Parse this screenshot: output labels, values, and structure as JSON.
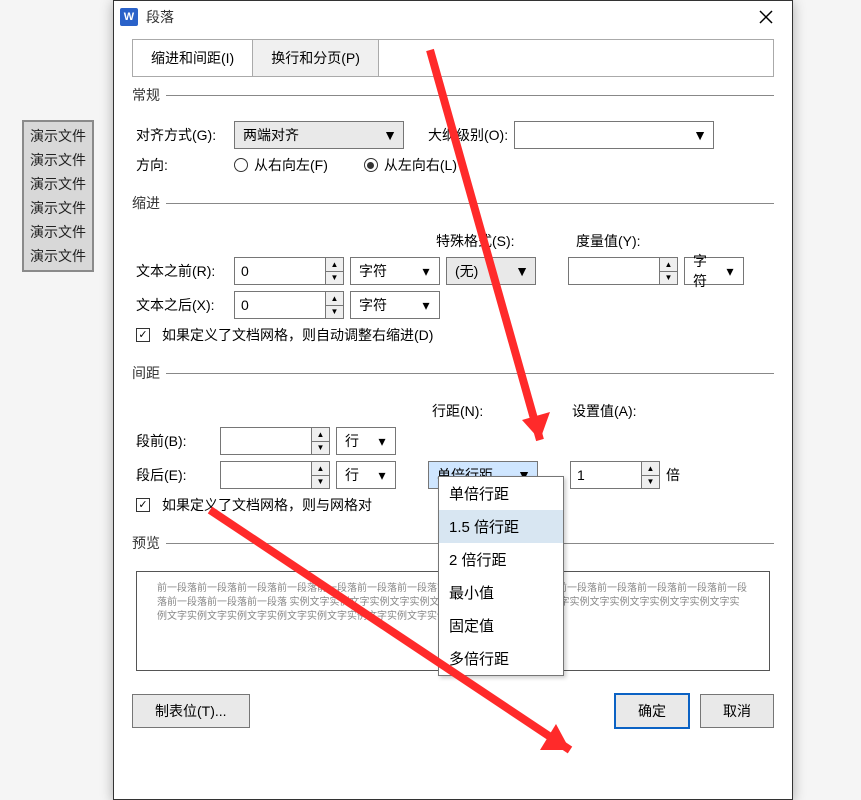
{
  "background_list": [
    "演示文件",
    "演示文件",
    "演示文件",
    "演示文件",
    "演示文件",
    "演示文件"
  ],
  "dialog": {
    "logo": "W",
    "title": "段落",
    "tabs": [
      {
        "label": "缩进和间距(I)",
        "active": true
      },
      {
        "label": "换行和分页(P)",
        "active": false
      }
    ],
    "general": {
      "legend": "常规",
      "align_label": "对齐方式(G):",
      "align_value": "两端对齐",
      "outline_label": "大纲级别(O):",
      "outline_value": "",
      "direction_label": "方向:",
      "dir_rtl": "从右向左(F)",
      "dir_ltr": "从左向右(L)"
    },
    "indent": {
      "legend": "缩进",
      "before_label": "文本之前(R):",
      "before_value": "0",
      "unit_char": "字符",
      "special_label": "特殊格式(S):",
      "special_value": "(无)",
      "measure_label": "度量值(Y):",
      "measure_value": "",
      "measure_unit": "字符",
      "after_label": "文本之后(X):",
      "after_value": "0",
      "grid_checkbox": "如果定义了文档网格，则自动调整右缩进(D)"
    },
    "spacing": {
      "legend": "间距",
      "before_label": "段前(B):",
      "before_value": "",
      "after_label": "段后(E):",
      "after_value": "",
      "unit_line": "行",
      "linespacing_label": "行距(N):",
      "linespacing_value": "单倍行距",
      "setvalue_label": "设置值(A):",
      "setvalue_value": "1",
      "setvalue_unit": "倍",
      "options": [
        "单倍行距",
        "1.5 倍行距",
        "2 倍行距",
        "最小值",
        "固定值",
        "多倍行距"
      ],
      "grid_checkbox": "如果定义了文档网格，则与网格对"
    },
    "preview_legend": "预览",
    "preview_text": "前一段落前一段落前一段落前一段落前一段落前一段落前一段落前一段落前一段落前一段落前一段落前一段落前一段落前一段落前一段落前一段落前一段落前一段落\n实例文字实例文字实例文字实例文字实例文字实例文字实例文字实例文字实例文字实例文字实例文字实例文字实例文字实例文字实例文字实例文字实例文字实例文字实例文字实例文字",
    "buttons": {
      "tabs": "制表位(T)...",
      "ok": "确定",
      "cancel": "取消"
    }
  }
}
